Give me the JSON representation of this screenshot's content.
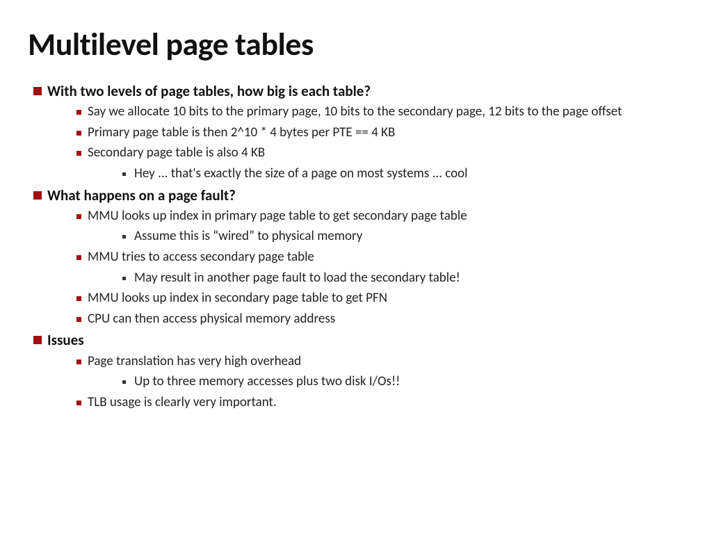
{
  "title": "Multilevel page tables",
  "sections": [
    {
      "heading": "With two levels of page tables, how big is each table?",
      "items": [
        {
          "text": "Say we allocate 10 bits to the primary page, 10 bits to the secondary page, 12 bits to the page offset",
          "sub": []
        },
        {
          "text": "Primary page table is then 2^10 * 4 bytes per PTE == 4 KB",
          "sub": []
        },
        {
          "text": "Secondary page table is also 4 KB",
          "sub": [
            "Hey ... that's exactly the size of a page on most systems ... cool"
          ]
        }
      ]
    },
    {
      "heading": "What happens on a page fault?",
      "items": [
        {
          "text": "MMU looks up index in primary page table to get secondary page table",
          "sub": [
            "Assume this is “wired” to physical memory"
          ]
        },
        {
          "text": "MMU tries to access secondary page table",
          "sub": [
            "May result in another page fault to load the secondary table!"
          ]
        },
        {
          "text": "MMU looks up index in secondary page table to get PFN",
          "sub": []
        },
        {
          "text": "CPU can then access physical memory address",
          "sub": []
        }
      ]
    },
    {
      "heading": "Issues",
      "items": [
        {
          "text": "Page translation has very high overhead",
          "sub": [
            "Up to three memory accesses plus two disk I/Os!!"
          ]
        },
        {
          "text": "TLB usage is clearly very important.",
          "sub": []
        }
      ]
    }
  ]
}
